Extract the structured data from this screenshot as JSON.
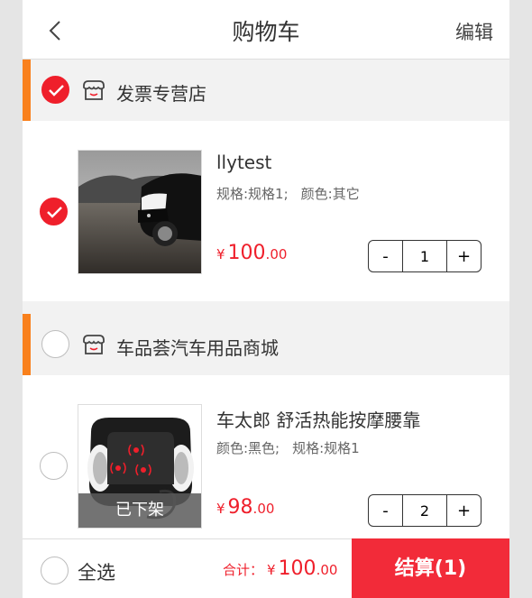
{
  "header": {
    "title": "购物车",
    "edit_label": "编辑"
  },
  "shops": [
    {
      "name": "发票专营店",
      "checked": true,
      "items": [
        {
          "name": "llytest",
          "specs": [
            "规格:规格1;",
            "颜色:其它"
          ],
          "yen": "¥",
          "price_int": "100",
          "price_dec": ".00",
          "qty": "1",
          "minus": "-",
          "plus": "+",
          "checked": true
        }
      ]
    },
    {
      "name": "车品荟汽车用品商城",
      "checked": false,
      "items": [
        {
          "name": "车太郎 舒活热能按摩腰靠",
          "specs": [
            "颜色:黑色;",
            "规格:规格1"
          ],
          "yen": "¥",
          "price_int": "98",
          "price_dec": ".00",
          "qty": "2",
          "minus": "-",
          "plus": "+",
          "checked": false,
          "status": "已下架"
        }
      ]
    }
  ],
  "footer": {
    "select_all_label": "全选",
    "total_label": "合计：",
    "total_yen": "¥",
    "total_int": "100",
    "total_dec": ".00",
    "checkout_label": "结算(1)"
  },
  "colors": {
    "accent": "#ef1f2b",
    "checkout_bg": "#f22b39",
    "shop_bar": "#f9801c"
  },
  "icons": [
    "chevron-left-icon",
    "checkmark-icon",
    "store-icon"
  ]
}
